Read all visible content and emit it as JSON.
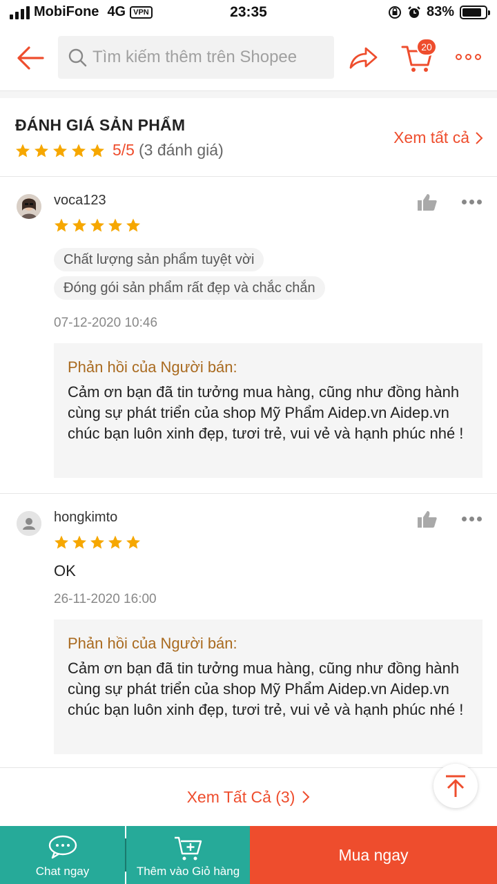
{
  "status_bar": {
    "carrier": "MobiFone",
    "network": "4G",
    "vpn": "VPN",
    "time": "23:35",
    "battery": "83%",
    "battery_level": 0.83
  },
  "header": {
    "search_placeholder": "Tìm kiếm thêm trên Shopee",
    "cart_count": "20",
    "accent_color": "#ee4d2d"
  },
  "summary": {
    "title": "ĐÁNH GIÁ SẢN PHẨM",
    "stars": 5,
    "score": "5/5",
    "count": "(3 đánh giá)",
    "see_all": "Xem tất cả"
  },
  "reviews": [
    {
      "username": "voca123",
      "stars": 5,
      "tags": [
        "Chất lượng sản phẩm tuyệt vời",
        "Đóng gói sản phẩm rất đẹp và chắc chắn"
      ],
      "comment": "",
      "date": "07-12-2020 10:46",
      "reply_title": "Phản hồi của Người bán:",
      "reply_text": "Cảm ơn bạn đã tin tưởng mua hàng, cũng như đồng hành cùng sự phát triển của shop Mỹ Phẩm Aidep.vn Aidep.vn chúc bạn luôn xinh đẹp, tươi trẻ, vui vẻ và hạnh phúc nhé !"
    },
    {
      "username": "hongkimto",
      "stars": 5,
      "tags": [],
      "comment": "OK",
      "date": "26-11-2020 16:00",
      "reply_title": "Phản hồi của Người bán:",
      "reply_text": "Cảm ơn bạn đã tin tưởng mua hàng, cũng như đồng hành cùng sự phát triển của shop Mỹ Phẩm Aidep.vn Aidep.vn chúc bạn luôn xinh đẹp, tươi trẻ, vui vẻ và hạnh phúc nhé !"
    }
  ],
  "view_all": "Xem Tất Cả (3)",
  "bottom_bar": {
    "chat": "Chat ngay",
    "add_to_cart": "Thêm vào Giỏ hàng",
    "buy_now": "Mua ngay",
    "teal": "#26aa99",
    "orange": "#ee4d2d"
  }
}
